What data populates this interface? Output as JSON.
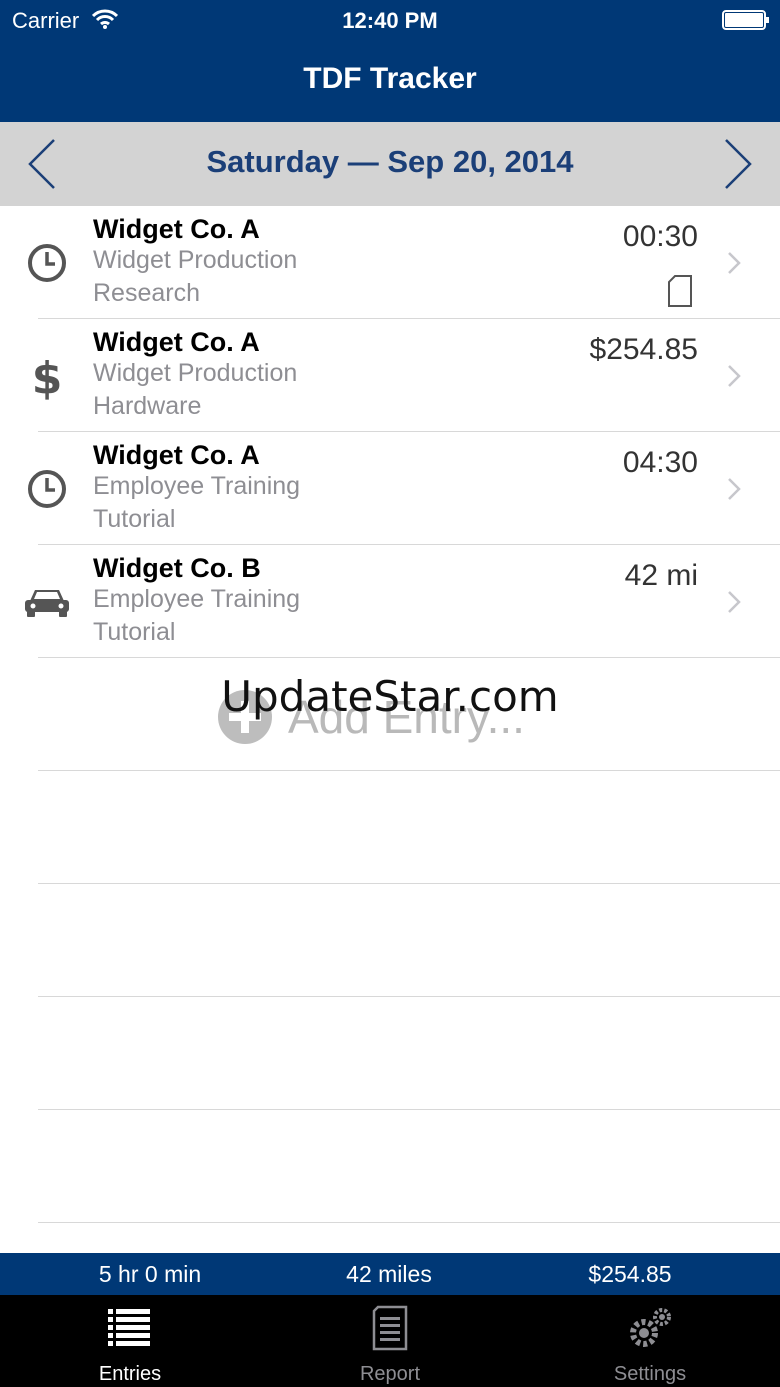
{
  "status_bar": {
    "carrier": "Carrier",
    "time": "12:40 PM",
    "wifi_icon": "wifi-icon",
    "battery_icon": "battery-icon"
  },
  "nav": {
    "title": "TDF Tracker"
  },
  "date_bar": {
    "label": "Saturday — Sep 20, 2014",
    "prev_icon": "chevron-left-icon",
    "next_icon": "chevron-right-icon"
  },
  "entries": [
    {
      "type_icon": "clock-icon",
      "client": "Widget Co. A",
      "project": "Widget Production",
      "task": "Research",
      "amount": "00:30",
      "note_icon": "note-icon"
    },
    {
      "type_icon": "dollar-icon",
      "client": "Widget Co. A",
      "project": "Widget Production",
      "task": "Hardware",
      "amount": "$254.85"
    },
    {
      "type_icon": "clock-icon",
      "client": "Widget Co. A",
      "project": "Employee Training",
      "task": "Tutorial",
      "amount": "04:30"
    },
    {
      "type_icon": "car-icon",
      "client": "Widget Co. B",
      "project": "Employee Training",
      "task": "Tutorial",
      "amount": "42 mi"
    }
  ],
  "add_entry": {
    "label": "Add Entry...",
    "icon": "plus-circle-icon",
    "watermark": "UpdateStar.com"
  },
  "summary": {
    "time_total": "5 hr 0 min",
    "miles_total": "42 miles",
    "expense_total": "$254.85"
  },
  "tabs": [
    {
      "label": "Entries",
      "icon": "list-icon",
      "active": true
    },
    {
      "label": "Report",
      "icon": "report-icon",
      "active": false
    },
    {
      "label": "Settings",
      "icon": "gears-icon",
      "active": false
    }
  ],
  "colors": {
    "brand": "#003876",
    "date_text": "#1b3f78",
    "date_bar_bg": "#d3d3d3",
    "secondary_text": "#8e8e93"
  }
}
